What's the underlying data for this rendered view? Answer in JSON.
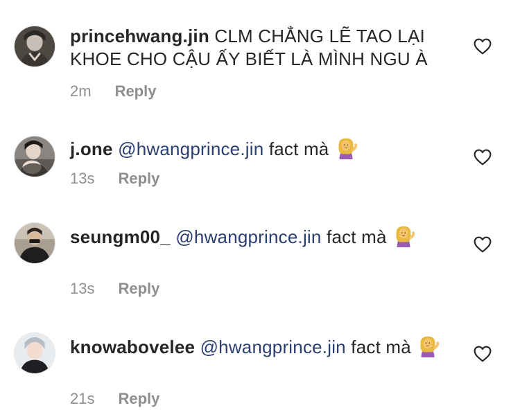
{
  "comments": [
    {
      "username": "princehwang.jin",
      "mention": "",
      "text": "CLM CHẲNG LẼ TAO LẠI KHOE CHO CẬU ẤY BIẾT LÀ MÌNH NGU À",
      "time": "2m",
      "reply_label": "Reply",
      "emoji": ""
    },
    {
      "username": "j.one",
      "mention": "@hwangprince.jin",
      "text": "fact mà",
      "time": "13s",
      "reply_label": "Reply",
      "emoji": "person-tipping-hand"
    },
    {
      "username": "seungm00_",
      "mention": "@hwangprince.jin",
      "text": "fact mà",
      "time": "13s",
      "reply_label": "Reply",
      "emoji": "person-tipping-hand"
    },
    {
      "username": "knowabovelee",
      "mention": "@hwangprince.jin",
      "text": "fact mà",
      "time": "21s",
      "reply_label": "Reply",
      "emoji": "person-tipping-hand"
    }
  ],
  "icons": {
    "like": "heart-outline-icon",
    "emoji": "person-tipping-hand-emoji"
  },
  "colors": {
    "text": "#262626",
    "mention": "#2a3e70",
    "meta": "#8e8e8e"
  }
}
